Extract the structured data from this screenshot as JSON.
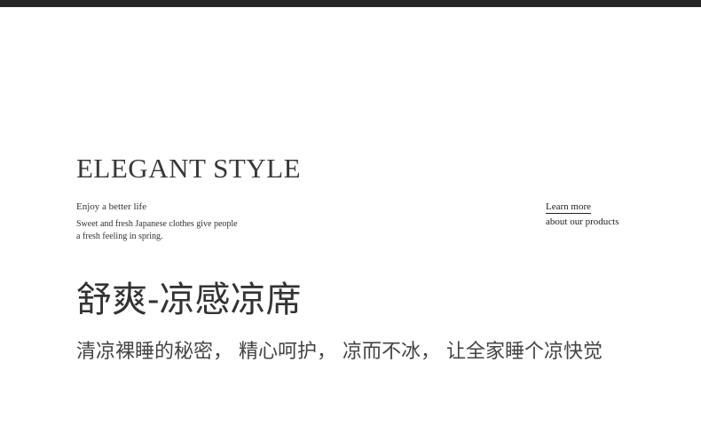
{
  "header": {
    "bar_color": "#262626"
  },
  "hero": {
    "title": "ELEGANT STYLE",
    "tagline": "Enjoy a better life",
    "description_line1": "Sweet and fresh Japanese clothes give people",
    "description_line2": "a fresh feeling in spring."
  },
  "cta": {
    "link_label": "Learn more",
    "sub_label": "about our products"
  },
  "product": {
    "heading": "舒爽-凉感凉席",
    "subheading": "清凉裸睡的秘密，  精心呵护，  凉而不冰，  让全家睡个凉快觉"
  }
}
